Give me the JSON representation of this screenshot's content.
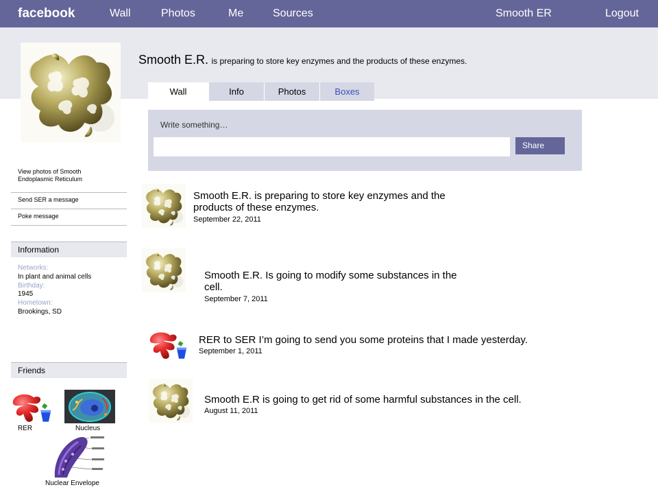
{
  "nav": {
    "brand": "facebook",
    "items": [
      "Wall",
      "Photos",
      "Me",
      "Sources"
    ],
    "profile_name": "Smooth ER",
    "logout": "Logout"
  },
  "profile": {
    "name": "Smooth E.R.",
    "status": "is preparing to store key enzymes and the products of these enzymes."
  },
  "tabs": [
    "Wall",
    "Info",
    "Photos",
    "Boxes"
  ],
  "compose": {
    "label": "Write something…",
    "share_label": "Share"
  },
  "sidebar": {
    "links": [
      "View photos of Smooth Endoplasmic Reticulum",
      "Send SER a message",
      "Poke message"
    ],
    "info_header": "Information",
    "info": {
      "networks_label": "Networks:",
      "networks_value": "In plant and animal cells",
      "birthday_label": "Birthday:",
      "birthday_value": "1945",
      "hometown_label": "Hometown:",
      "hometown_value": "Brookings, SD"
    },
    "friends_header": "Friends",
    "friends": [
      "RER",
      "Nucleus",
      "Nuclear Envelope"
    ]
  },
  "posts": [
    {
      "text": "Smooth E.R. is preparing to store key enzymes and the products of these enzymes.",
      "date": "September 22, 2011"
    },
    {
      "text": "Smooth E.R.  Is going to modify some substances in the cell.",
      "date": "September 7, 2011"
    },
    {
      "text": "RER to SER I’m going to send you some proteins that I made yesterday.",
      "date": "September 1, 2011"
    },
    {
      "text": "Smooth E.R is going to get rid of some harmful substances in the cell.",
      "date": "August 11, 2011"
    }
  ],
  "colors": {
    "nav": "#64669a",
    "banner": "#e8e9ef",
    "tab_inactive": "#d5d7e4",
    "link": "#3b4fb8"
  }
}
